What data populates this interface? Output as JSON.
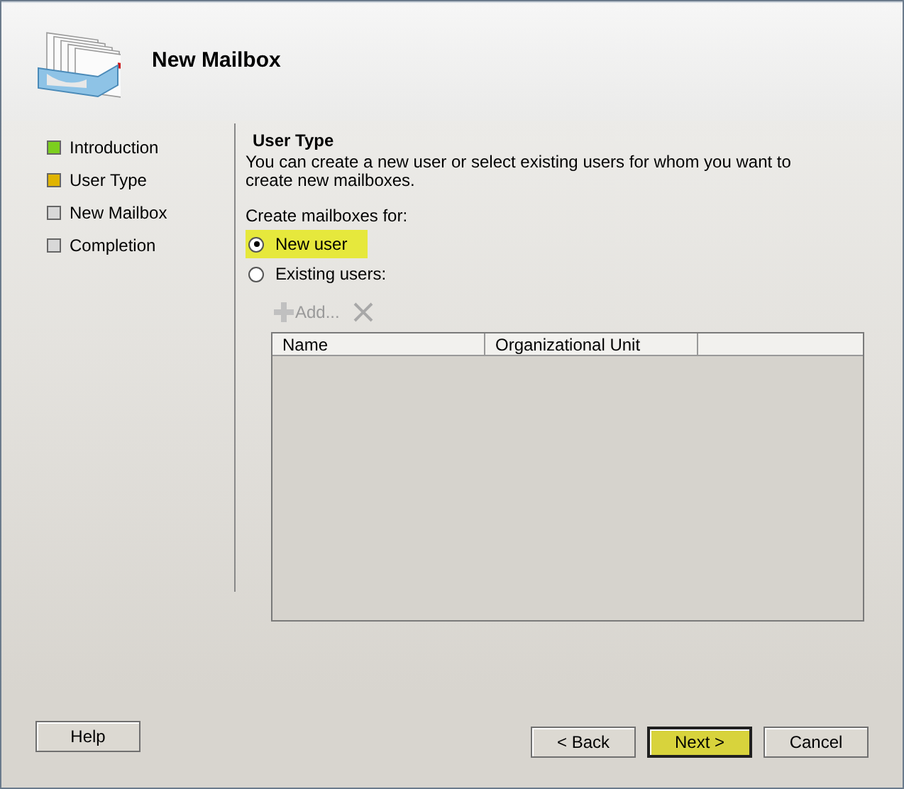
{
  "header": {
    "title": "New Mailbox"
  },
  "steps": [
    {
      "label": "Introduction",
      "color": "#7ccf1e"
    },
    {
      "label": "User Type",
      "color": "#e0b400"
    },
    {
      "label": "New Mailbox",
      "color": "#d8d8d8"
    },
    {
      "label": "Completion",
      "color": "#d8d8d8"
    }
  ],
  "page": {
    "heading": "User Type",
    "description": "You can create a new user or select existing users for whom you want to create new mailboxes.",
    "group_label": "Create mailboxes for:"
  },
  "options": [
    {
      "label": "New user",
      "selected": true,
      "highlighted": true
    },
    {
      "label": "Existing users:",
      "selected": false,
      "highlighted": false
    }
  ],
  "toolbar": {
    "add_label": "Add...",
    "disabled": true
  },
  "table": {
    "columns": [
      "Name",
      "Organizational Unit"
    ]
  },
  "help_button": {
    "label": "Help",
    "highlighted": false
  },
  "buttons": [
    {
      "label": "< Back",
      "highlighted": false
    },
    {
      "label": "Next >",
      "highlighted": true
    },
    {
      "label": "Cancel",
      "highlighted": false
    }
  ]
}
